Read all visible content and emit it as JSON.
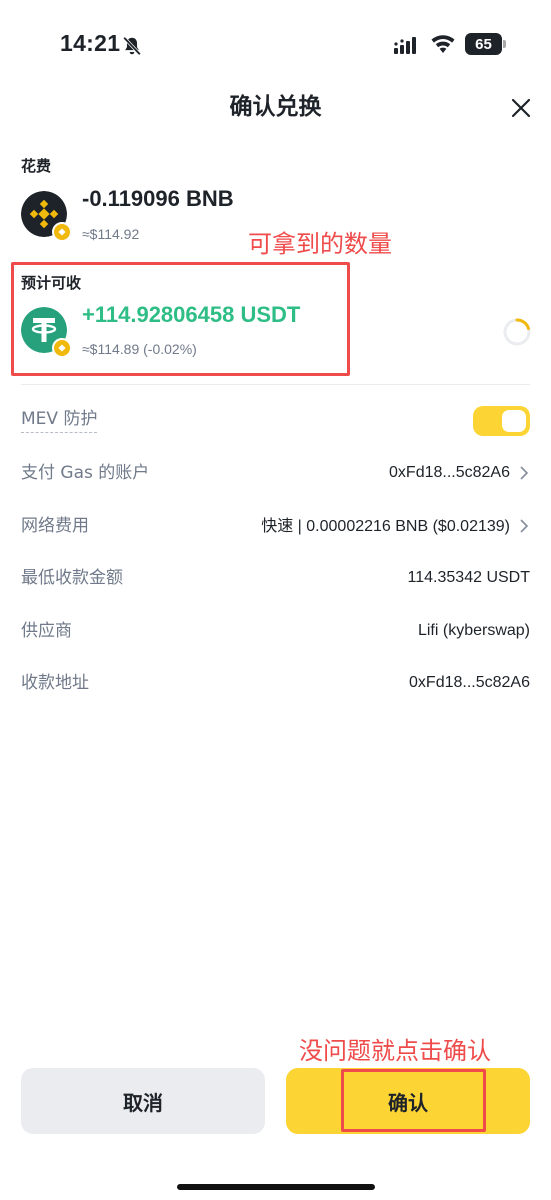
{
  "status_bar": {
    "time": "14:21",
    "battery": "65",
    "icons": [
      "bell-slash-icon",
      "signal-icon",
      "wifi-icon",
      "battery-icon"
    ]
  },
  "header": {
    "title": "确认兑换",
    "close_icon": "close-icon"
  },
  "spend": {
    "label": "花费",
    "amount": "-0.119096 BNB",
    "usd": "≈$114.92",
    "token_icon": "bnb-token-icon"
  },
  "receive": {
    "label": "预计可收",
    "amount": "+114.92806458 USDT",
    "usd": "≈$114.89 (-0.02%)",
    "token_icon": "usdt-token-icon"
  },
  "annotations": {
    "receive_note": "可拿到的数量",
    "confirm_note": "没问题就点击确认",
    "color": "#ef4b4b"
  },
  "details": {
    "mev": {
      "label": "MEV 防护",
      "enabled": true
    },
    "gas_account": {
      "label": "支付 Gas 的账户",
      "value": "0xFd18...5c82A6"
    },
    "network_fee": {
      "label": "网络费用",
      "speed": "快速",
      "value": " | 0.00002216 BNB ($0.02139)"
    },
    "min_receive": {
      "label": "最低收款金额",
      "value": "114.35342 USDT"
    },
    "provider": {
      "label": "供应商",
      "value": "Lifi (kyberswap)"
    },
    "receive_address": {
      "label": "收款地址",
      "value": "0xFd18...5c82A6"
    }
  },
  "buttons": {
    "cancel": "取消",
    "confirm": "确认"
  },
  "colors": {
    "accent": "#fcd535",
    "positive": "#2ebd85",
    "muted": "#707a8a",
    "text": "#1e2329"
  }
}
